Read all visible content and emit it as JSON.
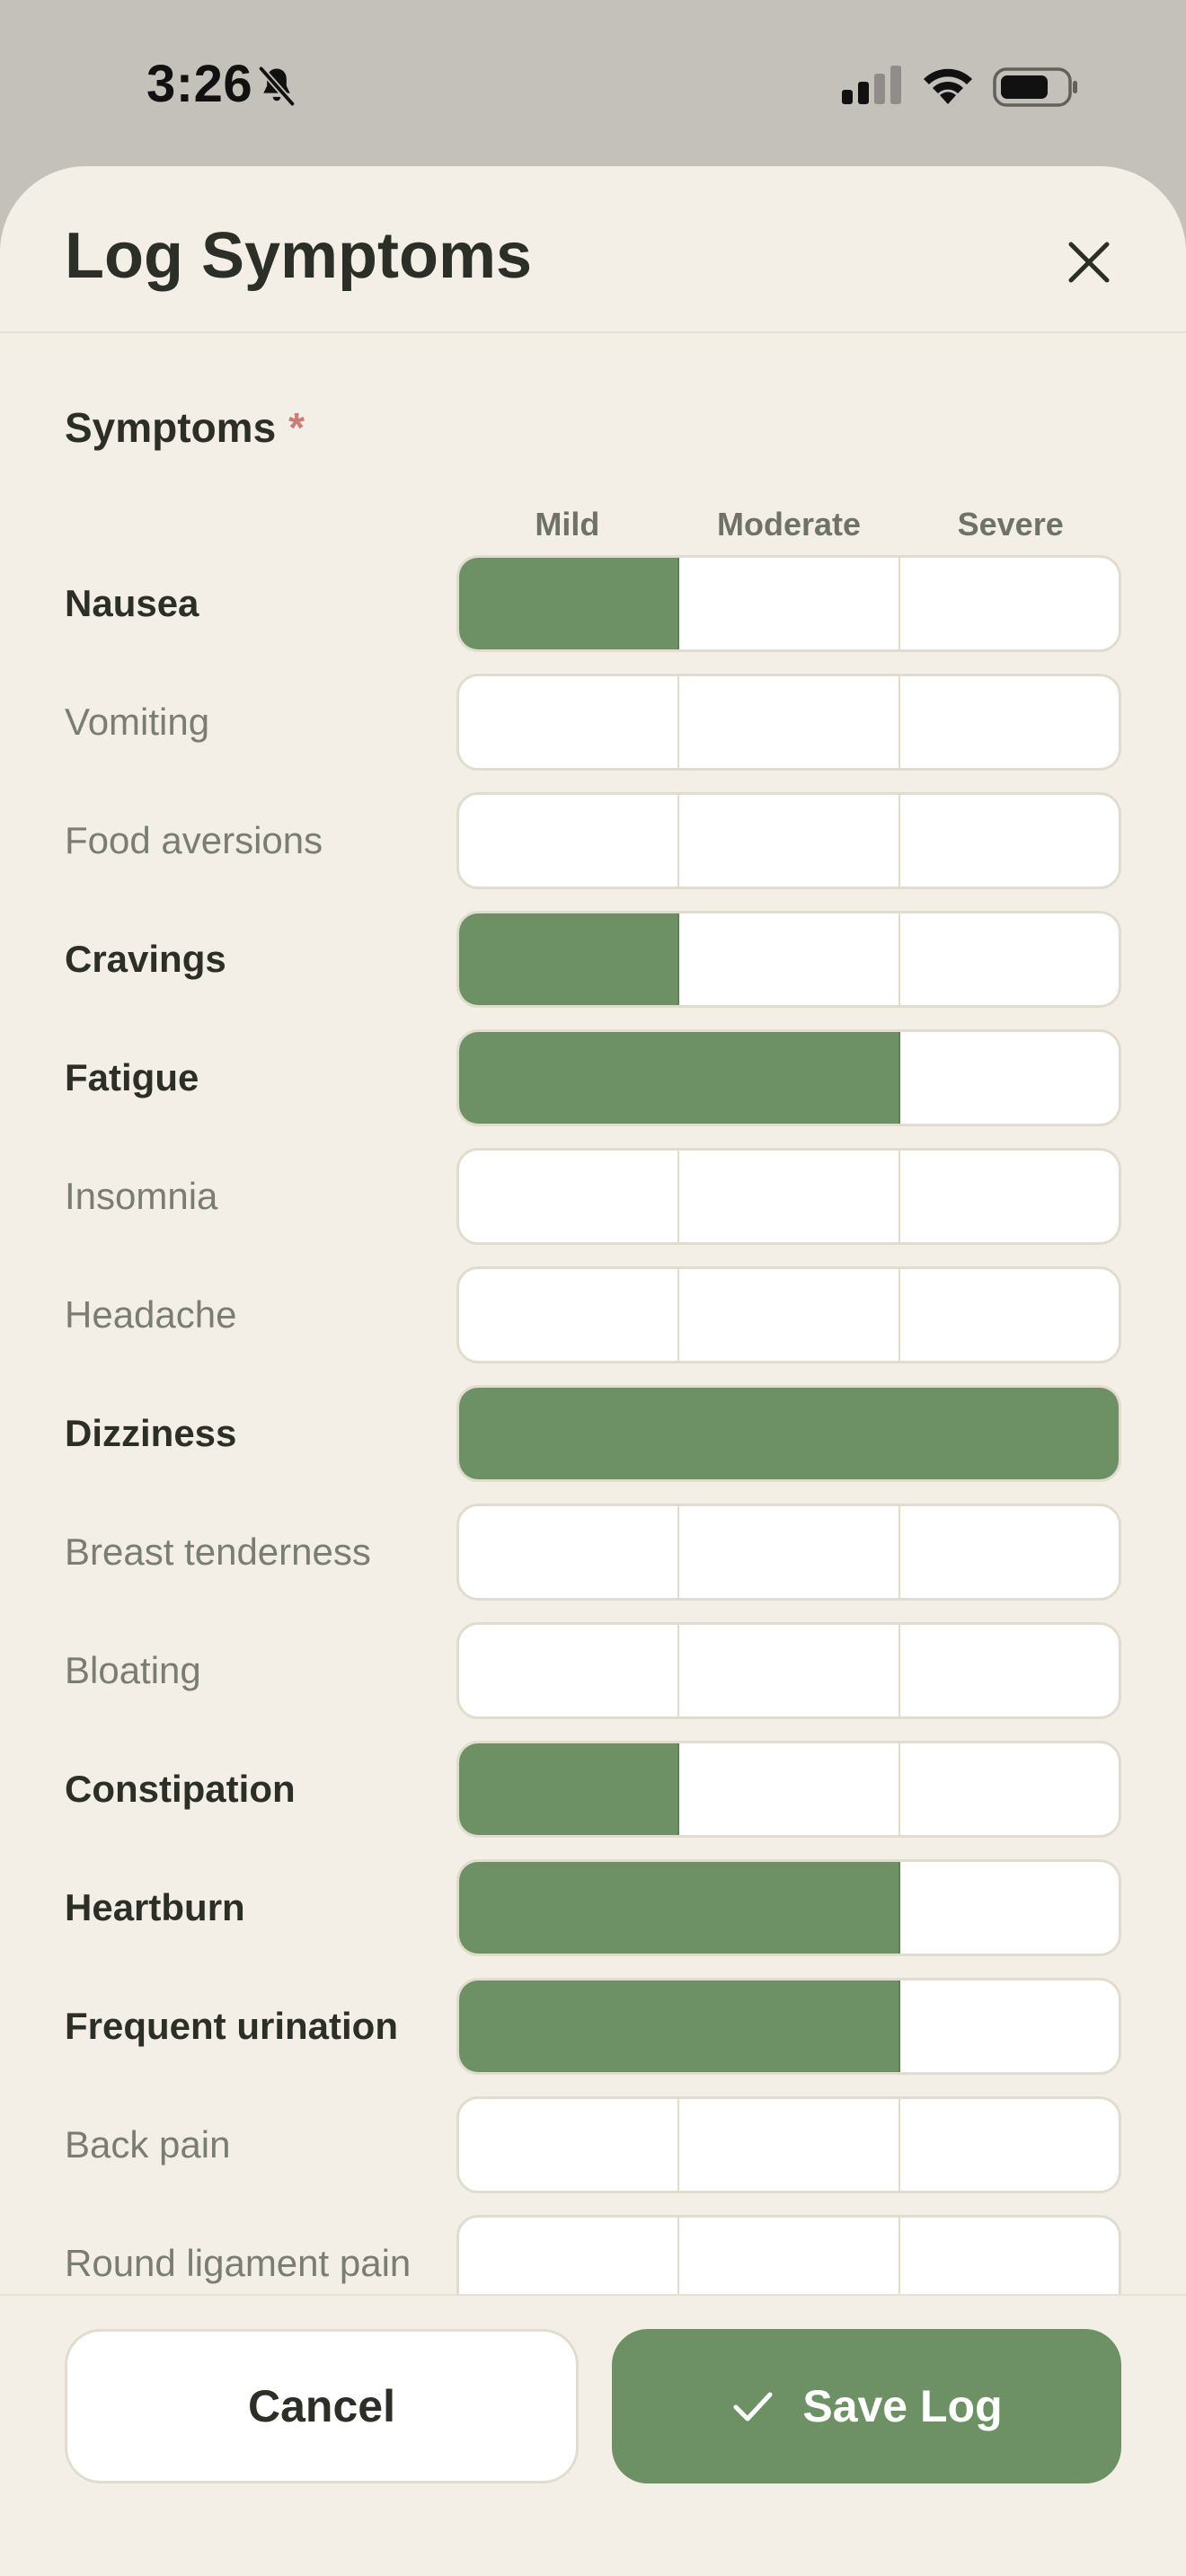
{
  "status_bar": {
    "time": "3:26",
    "icons": [
      "bell-slash-icon",
      "cellular-signal-icon",
      "wifi-icon",
      "battery-icon"
    ]
  },
  "sheet": {
    "title": "Log Symptoms",
    "close_icon": "close-icon"
  },
  "symptoms": {
    "label": "Symptoms",
    "required_marker": "*",
    "severity_levels": [
      "Mild",
      "Moderate",
      "Severe"
    ],
    "items": [
      {
        "name": "Nausea",
        "severity": 1
      },
      {
        "name": "Vomiting",
        "severity": 0
      },
      {
        "name": "Food aversions",
        "severity": 0
      },
      {
        "name": "Cravings",
        "severity": 1
      },
      {
        "name": "Fatigue",
        "severity": 2
      },
      {
        "name": "Insomnia",
        "severity": 0
      },
      {
        "name": "Headache",
        "severity": 0
      },
      {
        "name": "Dizziness",
        "severity": 3
      },
      {
        "name": "Breast tenderness",
        "severity": 0
      },
      {
        "name": "Bloating",
        "severity": 0
      },
      {
        "name": "Constipation",
        "severity": 1
      },
      {
        "name": "Heartburn",
        "severity": 2
      },
      {
        "name": "Frequent urination",
        "severity": 2
      },
      {
        "name": "Back pain",
        "severity": 0
      },
      {
        "name": "Round ligament pain",
        "severity": 0
      }
    ]
  },
  "footer": {
    "cancel_label": "Cancel",
    "save_label": "Save Log",
    "save_icon": "check-icon"
  },
  "colors": {
    "accent": "#6e9065",
    "background": "#f4efe6",
    "required": "#c97d78"
  }
}
